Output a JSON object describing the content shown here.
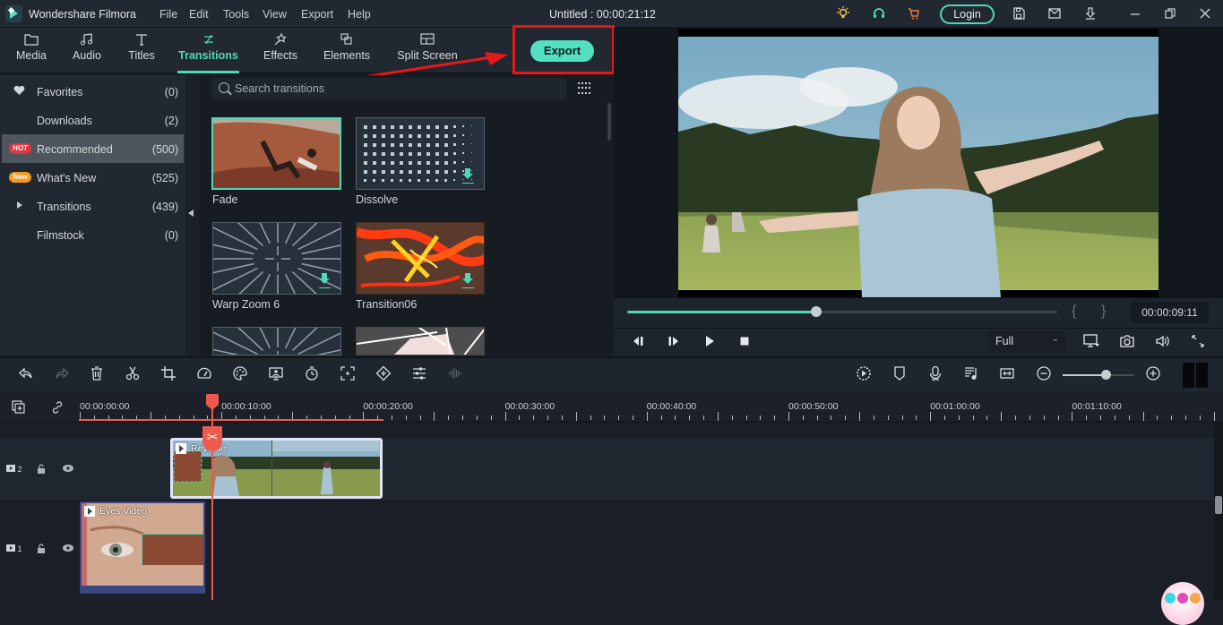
{
  "app": {
    "name": "Wondershare Filmora",
    "document_title": "Untitled : 00:00:21:12",
    "menu": [
      "File",
      "Edit",
      "Tools",
      "View",
      "Export",
      "Help"
    ],
    "login_label": "Login",
    "title_icons": [
      "lightbulb-icon",
      "headset-icon",
      "cart-icon",
      "save-icon",
      "mail-icon",
      "download-icon",
      "minimize-icon",
      "restore-icon",
      "close-icon"
    ],
    "accent_color": "#4fd8b7"
  },
  "tabs": [
    {
      "label": "Media",
      "icon": "folder-icon",
      "active": false
    },
    {
      "label": "Audio",
      "icon": "music-note-icon",
      "active": false
    },
    {
      "label": "Titles",
      "icon": "text-icon",
      "active": false
    },
    {
      "label": "Transitions",
      "icon": "transitions-icon",
      "active": true
    },
    {
      "label": "Effects",
      "icon": "effects-icon",
      "active": false
    },
    {
      "label": "Elements",
      "icon": "elements-icon",
      "active": false
    },
    {
      "label": "Split Screen",
      "icon": "split-screen-icon",
      "active": false
    }
  ],
  "export_label": "Export",
  "categories": [
    {
      "label": "Favorites",
      "count": "(0)",
      "badge": "",
      "icon": "heart-icon"
    },
    {
      "label": "Downloads",
      "count": "(2)",
      "badge": ""
    },
    {
      "label": "Recommended",
      "count": "(500)",
      "badge": "HOT",
      "selected": true
    },
    {
      "label": "What's New",
      "count": "(525)",
      "badge": "New"
    },
    {
      "label": "Transitions",
      "count": "(439)",
      "badge": "",
      "icon": "expand-arrow-icon"
    },
    {
      "label": "Filmstock",
      "count": "(0)",
      "badge": ""
    }
  ],
  "search": {
    "placeholder": "Search transitions",
    "value": ""
  },
  "transitions": [
    {
      "label": "Fade",
      "selected": true,
      "downloadable": false
    },
    {
      "label": "Dissolve",
      "selected": false,
      "downloadable": true
    },
    {
      "label": "Warp Zoom 6",
      "selected": false,
      "downloadable": true
    },
    {
      "label": "Transition06",
      "selected": false,
      "downloadable": true
    },
    {
      "label": "",
      "selected": false
    },
    {
      "label": "",
      "selected": false
    }
  ],
  "player": {
    "progress": 0.44,
    "timecode": "00:00:09:11",
    "mark_in": "{",
    "mark_out": "}",
    "zoom_value": "Full",
    "zoom_caret": "⌄"
  },
  "toolbar": {
    "left": [
      "undo-icon",
      "redo-icon",
      "delete-icon",
      "cut-icon",
      "crop-icon",
      "speed-icon",
      "color-icon",
      "green-screen-icon",
      "duration-icon",
      "focus-icon",
      "keyframe-icon",
      "adjust-icon",
      "audio-wave-icon"
    ],
    "right": [
      "render-preview-icon",
      "marker-icon",
      "record-voiceover-icon",
      "audio-mix-icon",
      "fit-timeline-icon"
    ],
    "timeline_zoom": 0.6
  },
  "ruler": {
    "labels": [
      "00:00:00:00",
      "00:00:10:00",
      "00:00:20:00",
      "00:00:30:00",
      "00:00:40:00",
      "00:00:50:00",
      "00:01:00:00",
      "00:01:10:00"
    ]
  },
  "tracks": [
    {
      "number": "2",
      "clip_name": "Reverse"
    },
    {
      "number": "1",
      "clip_name": "Eyes Video"
    }
  ],
  "playhead_time": "00:00:09:11"
}
